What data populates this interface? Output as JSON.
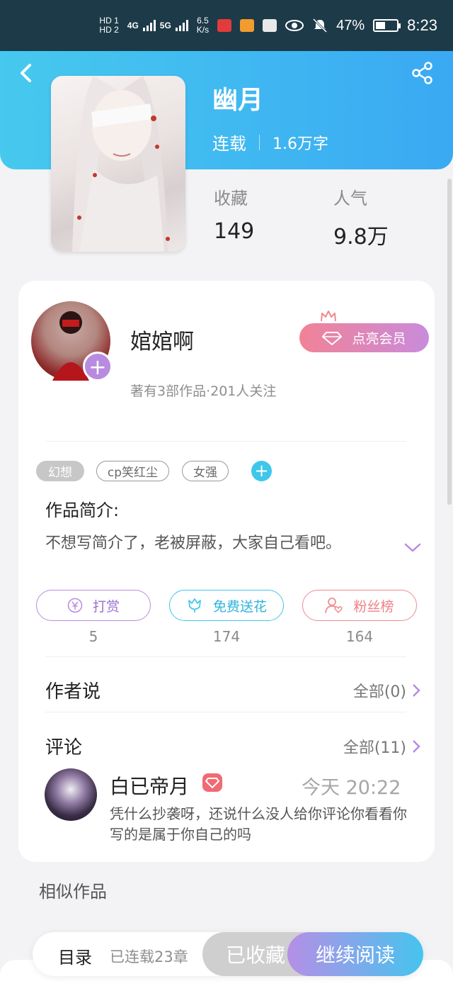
{
  "status_bar": {
    "hd1": "HD 1",
    "hd2": "HD 2",
    "net1": "4G",
    "net2": "5G",
    "speed": "6.5\nK/s",
    "apps": [
      "HUAWEI",
      "▶",
      "HMS"
    ],
    "battery_pct": "47%",
    "time": "8:23",
    "battery_level": 0.47
  },
  "book": {
    "title": "幽月",
    "status": "连载",
    "word_count": "1.6万字",
    "favorites_label": "收藏",
    "favorites_value": "149",
    "popularity_label": "人气",
    "popularity_value": "9.8万"
  },
  "author": {
    "name": "婠婠啊",
    "meta": "著有3部作品·201人关注",
    "vip_button": "点亮会员",
    "follow_plus": "+"
  },
  "tags": [
    "幻想",
    "cp笑红尘",
    "女强"
  ],
  "tag_add": "+",
  "intro": {
    "title": "作品简介:",
    "text": "不想写简介了，老被屏蔽，大家自己看吧。"
  },
  "actions": {
    "reward": {
      "label": "打赏",
      "count": "5"
    },
    "flower": {
      "label": "免费送花",
      "count": "174"
    },
    "fans": {
      "label": "粉丝榜",
      "count": "164"
    }
  },
  "author_says": {
    "title": "作者说",
    "link": "全部(0)"
  },
  "comments": {
    "title": "评论",
    "link": "全部(11)",
    "items": [
      {
        "user": "白已帝月",
        "time": "今天 20:22",
        "text": "凭什么抄袭呀，还说什么没人给你评论你看看你写的是属于你自己的吗"
      }
    ]
  },
  "similar_title": "相似作品",
  "bottom": {
    "toc": "目录",
    "chapters": "已连载23章",
    "collected": "已收藏",
    "continue": "继续阅读"
  },
  "colors": {
    "header_start": "#46c9ee",
    "header_end": "#3aa9f3",
    "accent_purple": "#b88be0",
    "accent_cyan": "#3ec7ea",
    "accent_pink": "#f08a8e"
  },
  "icons": [
    "back-icon",
    "share-icon",
    "crown-icon",
    "diamond-icon",
    "yen-icon",
    "flower-icon",
    "user-heart-icon",
    "chevron-down-icon",
    "chevron-right-icon",
    "eye-icon",
    "mute-icon"
  ]
}
